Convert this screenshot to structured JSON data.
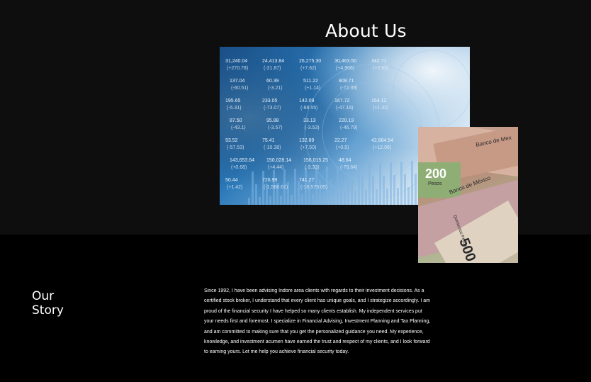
{
  "page": {
    "title": "About Us"
  },
  "images": {
    "stock": {
      "description_icon": "stock-market-ticker-image",
      "tickers": [
        [
          "31,240.04",
          "(+270.78)"
        ],
        [
          "24,413.84",
          "(-21.87)"
        ],
        [
          "26,275.30",
          "(+7.62)"
        ],
        [
          "30,463.50",
          "(+4,906)"
        ],
        [
          "342.71",
          "(+2.85)"
        ],
        [
          "137.04",
          "(-60.51)"
        ],
        [
          "60.39",
          "(-3.21)"
        ],
        [
          "511.22",
          "(+1.14)"
        ],
        [
          "808.71",
          "(-72.39)"
        ],
        [
          "195.65",
          "(-5.31)"
        ],
        [
          "233.05",
          "(-73.07)"
        ],
        [
          "142.09",
          "(-88.55)"
        ],
        [
          "167.72",
          "(-47.19)"
        ],
        [
          "154.12",
          "(+1.32)"
        ],
        [
          "87.50",
          "(-43.1)"
        ],
        [
          "95.88",
          "(-3.57)"
        ],
        [
          "33.13",
          "(-3.53)"
        ],
        [
          "220.19",
          "(-46.79)"
        ],
        [
          "93.52",
          "(-57.53)"
        ],
        [
          "75.41",
          "(-10.38)"
        ],
        [
          "132.89",
          "(+7.50)"
        ],
        [
          "22.27",
          "(+0.5)"
        ],
        [
          "42,684.54",
          "(+12.06)"
        ],
        [
          "143,653.64",
          "(+0.68)"
        ],
        [
          "150,028.14",
          "(+4.44)"
        ],
        [
          "156,015.25",
          "(-3.33)"
        ],
        [
          "48.64",
          "(-70.64)"
        ],
        [
          "50.44",
          "(+1.42)"
        ],
        [
          "726.99",
          "(-1,566.61)"
        ],
        [
          "741.27",
          "(-16,579.05)"
        ]
      ]
    },
    "banknotes": {
      "description_icon": "mexican-pesos-banknotes-image",
      "note_values": [
        "200",
        "500"
      ],
      "note_labels": [
        "Pesos",
        "Banco de México",
        "Quinientos Pesos",
        "Banco de Mex"
      ]
    }
  },
  "story": {
    "heading_line1": "Our",
    "heading_line2": "Story",
    "body": "Since 1992, I have been advising Indore area clients with regards to their investment decisions. As a certified stock broker, I understand that every client has unique goals, and I strategize accordingly. I am proud of the financial security I have helped so many clients establish.  My independent services put your needs first and foremost. I specialize in Financial Advising, Investment Planning and Tax Planning, and am committed to making sure that you get the personalized guidance you need. My experience, knowledge, and investment acumen have earned the trust and respect of my clients, and I look forward to earning yours. Let me help you achieve financial security today."
  }
}
